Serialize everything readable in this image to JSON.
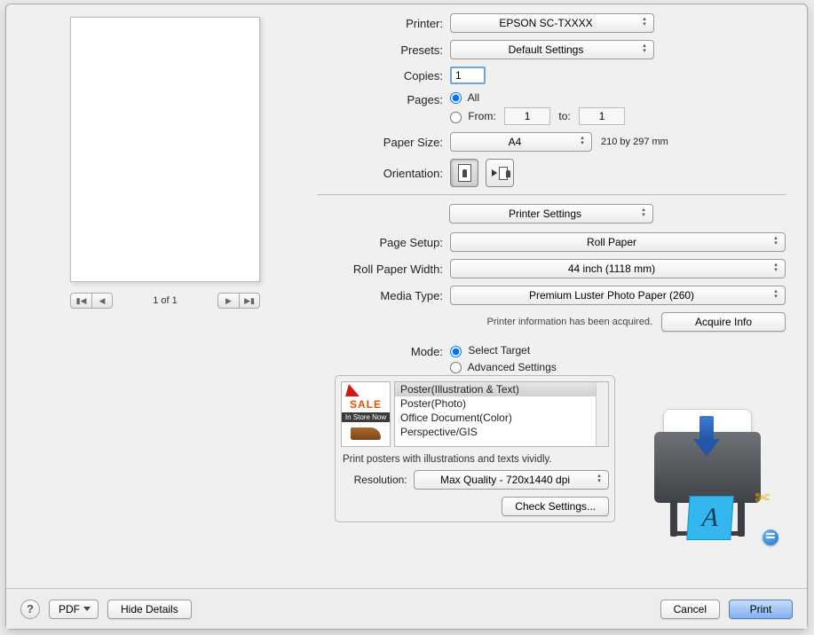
{
  "printer": {
    "label": "Printer:",
    "value": "EPSON SC-TXXXX"
  },
  "presets": {
    "label": "Presets:",
    "value": "Default Settings"
  },
  "copies": {
    "label": "Copies:",
    "value": "1"
  },
  "pages": {
    "label": "Pages:",
    "all_label": "All",
    "from_label": "From:",
    "to_label": "to:",
    "from_value": "1",
    "to_value": "1"
  },
  "paper_size": {
    "label": "Paper Size:",
    "value": "A4",
    "dims": "210 by 297 mm"
  },
  "orientation": {
    "label": "Orientation:"
  },
  "panel_selector": {
    "value": "Printer Settings"
  },
  "page_setup": {
    "label": "Page Setup:",
    "value": "Roll Paper"
  },
  "roll_width": {
    "label": "Roll Paper Width:",
    "value": "44 inch (1118 mm)"
  },
  "media_type": {
    "label": "Media Type:",
    "value": "Premium Luster Photo Paper (260)"
  },
  "printer_info": {
    "text": "Printer information has been acquired.",
    "button": "Acquire Info"
  },
  "mode": {
    "label": "Mode:",
    "select_target": "Select Target",
    "advanced": "Advanced Settings"
  },
  "targets": {
    "items": [
      "Poster(Illustration & Text)",
      "Poster(Photo)",
      "Office Document(Color)",
      "Perspective/GIS"
    ],
    "thumb": {
      "sale": "SALE",
      "instore": "In Store Now"
    },
    "description": "Print posters with illustrations and texts vividly."
  },
  "resolution": {
    "label": "Resolution:",
    "value": "Max Quality - 720x1440 dpi"
  },
  "check_settings": "Check Settings...",
  "preview": {
    "page_indicator": "1 of 1",
    "letter": "A"
  },
  "footer": {
    "pdf": "PDF",
    "hide_details": "Hide Details",
    "cancel": "Cancel",
    "print": "Print",
    "help": "?"
  }
}
